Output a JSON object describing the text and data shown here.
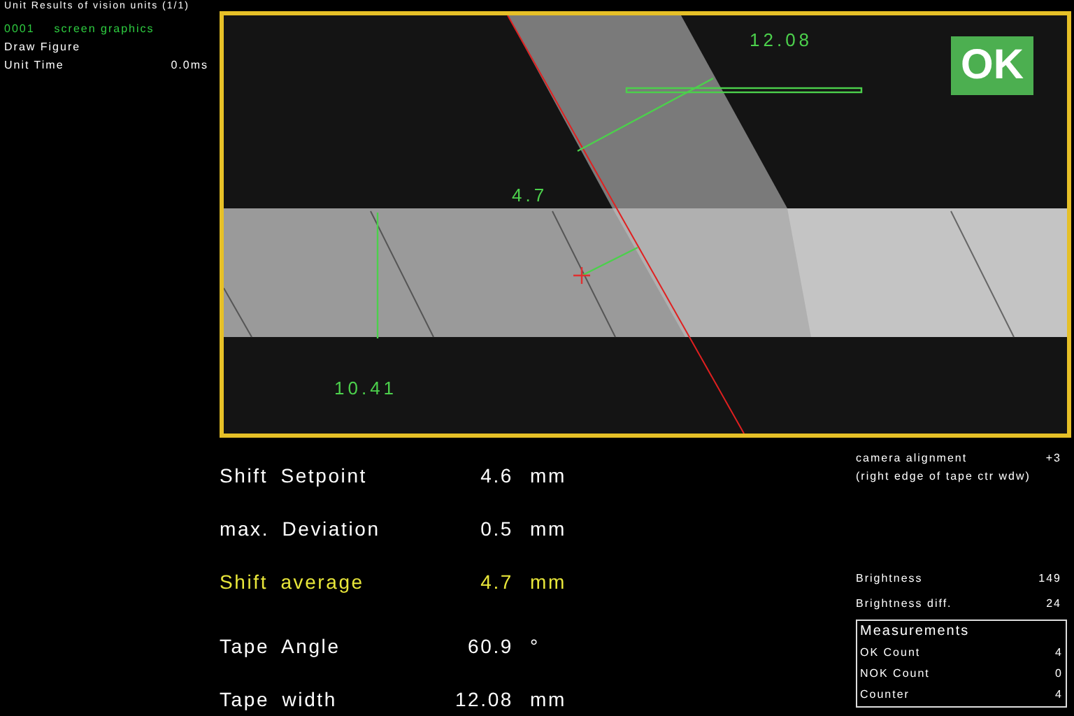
{
  "header": {
    "title": "Unit Results of vision units (1/1)"
  },
  "sidebar": {
    "unit_number": "0001",
    "unit_name": "screen graphics",
    "items": [
      {
        "label": "Draw Figure"
      },
      {
        "label": "Unit Time",
        "value": "0.0ms"
      }
    ]
  },
  "camera_view": {
    "status": "OK",
    "overlay_labels": [
      "12.08",
      "4.7",
      "10.41"
    ]
  },
  "measurements": [
    {
      "label": "Shift Setpoint",
      "value": "4.6",
      "unit": "mm",
      "highlighted": false
    },
    {
      "label": "max. Deviation",
      "value": "0.5",
      "unit": "mm",
      "highlighted": false
    },
    {
      "label": "Shift average",
      "value": "4.7",
      "unit": "mm",
      "highlighted": true
    },
    {
      "label": "Tape Angle",
      "value": "60.9",
      "unit": "°",
      "highlighted": false
    },
    {
      "label": "Tape width",
      "value": "12.08",
      "unit": "mm",
      "highlighted": false
    }
  ],
  "alignment": {
    "label": "camera alignment",
    "value": "+3",
    "note": "(right edge of tape ctr wdw)"
  },
  "brightness": [
    {
      "label": "Brightness",
      "value": "149"
    },
    {
      "label": "Brightness diff.",
      "value": "24"
    }
  ],
  "counters": {
    "title": "Measurements",
    "rows": [
      {
        "label": "OK Count",
        "value": "4"
      },
      {
        "label": "NOK Count",
        "value": "0"
      },
      {
        "label": "Counter",
        "value": "4"
      }
    ]
  }
}
